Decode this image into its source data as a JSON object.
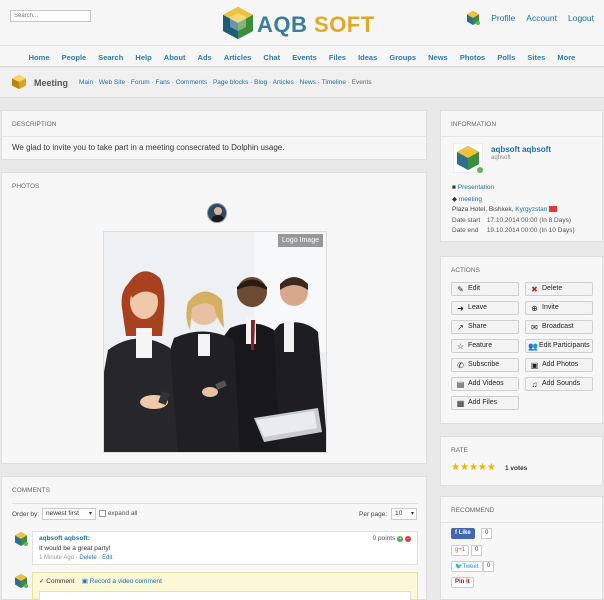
{
  "header": {
    "search_placeholder": "Search...",
    "logo_part1": "AQB",
    "logo_part2": "SOFT",
    "profile": "Profile",
    "account": "Account",
    "logout": "Logout"
  },
  "nav": [
    "Home",
    "People",
    "Search",
    "Help",
    "About",
    "Ads",
    "Articles",
    "Chat",
    "Events",
    "Files",
    "Ideas",
    "Groups",
    "News",
    "Photos",
    "Polls",
    "Sites",
    "More"
  ],
  "pagehead": {
    "title": "Meeting",
    "links": [
      "Main",
      "Web Site",
      "Forum",
      "Fans",
      "Comments",
      "Page blocks",
      "Blog",
      "Articles",
      "News",
      "Timeline"
    ],
    "current": "Events"
  },
  "description": {
    "heading": "DESCRIPTION",
    "text": "We glad to invite you to take part in a meeting consecrated to Dolphin usage."
  },
  "photos": {
    "heading": "PHOTOS",
    "overlay": "Logo Image"
  },
  "comments": {
    "heading": "COMMENTS",
    "order_label": "Order by:",
    "order_value": "newest first",
    "expand_all": "expand all",
    "per_page_label": "Per page:",
    "per_page_value": "10",
    "items": [
      {
        "author": "aqbsoft aqbsoft:",
        "text": "It would be a great party!",
        "time": "1 Minute Ago",
        "delete": "Delete",
        "edit": "Edit",
        "points": "0 points"
      }
    ],
    "comment_tab": "Comment",
    "video_tab": "Record a video comment"
  },
  "info": {
    "heading": "INFORMATION",
    "name": "aqbsoft aqbsoft",
    "username": "aqbsoft",
    "category": "Presentation",
    "tag": "meeting",
    "location_text": "Plaza Hotel, Bishkek,",
    "location_country": "Kyrgyzstan",
    "start_label": "Date start",
    "start_value": "17.10.2014 00:00 (In 8 Days)",
    "end_label": "Date end",
    "end_value": "19.10.2014 00:00 (In 10 Days)"
  },
  "actions": {
    "heading": "ACTIONS",
    "buttons": [
      {
        "label": "Edit",
        "icon": "edit-icon"
      },
      {
        "label": "Delete",
        "icon": "delete-icon"
      },
      {
        "label": "Leave",
        "icon": "leave-icon"
      },
      {
        "label": "Invite",
        "icon": "invite-icon"
      },
      {
        "label": "Share",
        "icon": "share-icon"
      },
      {
        "label": "Broadcast",
        "icon": "broadcast-icon"
      },
      {
        "label": "Feature",
        "icon": "star-icon"
      },
      {
        "label": "Edit Participants",
        "icon": "users-icon"
      },
      {
        "label": "Subscribe",
        "icon": "subscribe-icon"
      },
      {
        "label": "Add Photos",
        "icon": "photo-icon"
      },
      {
        "label": "Add Videos",
        "icon": "video-icon"
      },
      {
        "label": "Add Sounds",
        "icon": "music-icon"
      },
      {
        "label": "Add Files",
        "icon": "file-icon"
      }
    ]
  },
  "rate": {
    "heading": "RATE",
    "votes": "1 votes",
    "stars": 5
  },
  "recommend": {
    "heading": "RECOMMEND",
    "like": "Like",
    "like_count": "0",
    "gplus": "+1",
    "gplus_count": "0",
    "tweet": "Tweet",
    "tweet_count": "0",
    "pinit": "Pin it"
  },
  "colors": {
    "link": "#1b6fae",
    "accent": "#e2a823",
    "brand_blue": "#3a7d9c"
  }
}
